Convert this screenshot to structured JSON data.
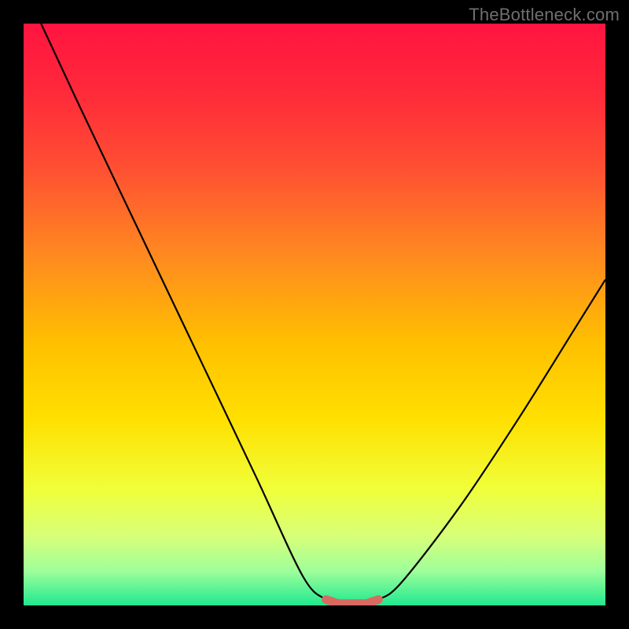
{
  "watermark": "TheBottleneck.com",
  "chart_data": {
    "type": "line",
    "title": "",
    "xlabel": "",
    "ylabel": "",
    "xlim": [
      0,
      100
    ],
    "ylim": [
      0,
      100
    ],
    "grid": false,
    "legend": false,
    "background_gradient": {
      "type": "vertical",
      "stops": [
        {
          "pos": 0.0,
          "color": "#ff1440"
        },
        {
          "pos": 0.12,
          "color": "#ff2a3a"
        },
        {
          "pos": 0.25,
          "color": "#ff5032"
        },
        {
          "pos": 0.4,
          "color": "#ff8a20"
        },
        {
          "pos": 0.55,
          "color": "#ffc000"
        },
        {
          "pos": 0.68,
          "color": "#ffe000"
        },
        {
          "pos": 0.8,
          "color": "#f0ff3a"
        },
        {
          "pos": 0.88,
          "color": "#d8ff78"
        },
        {
          "pos": 0.94,
          "color": "#a0ff9a"
        },
        {
          "pos": 1.0,
          "color": "#20e890"
        }
      ]
    },
    "series": [
      {
        "name": "bottleneck-curve",
        "color": "#000000",
        "x": [
          3,
          10,
          20,
          30,
          40,
          48,
          52,
          55,
          58,
          61,
          65,
          75,
          85,
          95,
          100
        ],
        "y": [
          100,
          85,
          64,
          43,
          22,
          5,
          1,
          0,
          0,
          1,
          4,
          17,
          32,
          48,
          56
        ]
      }
    ],
    "highlight": {
      "name": "optimal-zone",
      "color": "#d86a62",
      "x_range": [
        52,
        61
      ],
      "y": 0.8
    }
  }
}
